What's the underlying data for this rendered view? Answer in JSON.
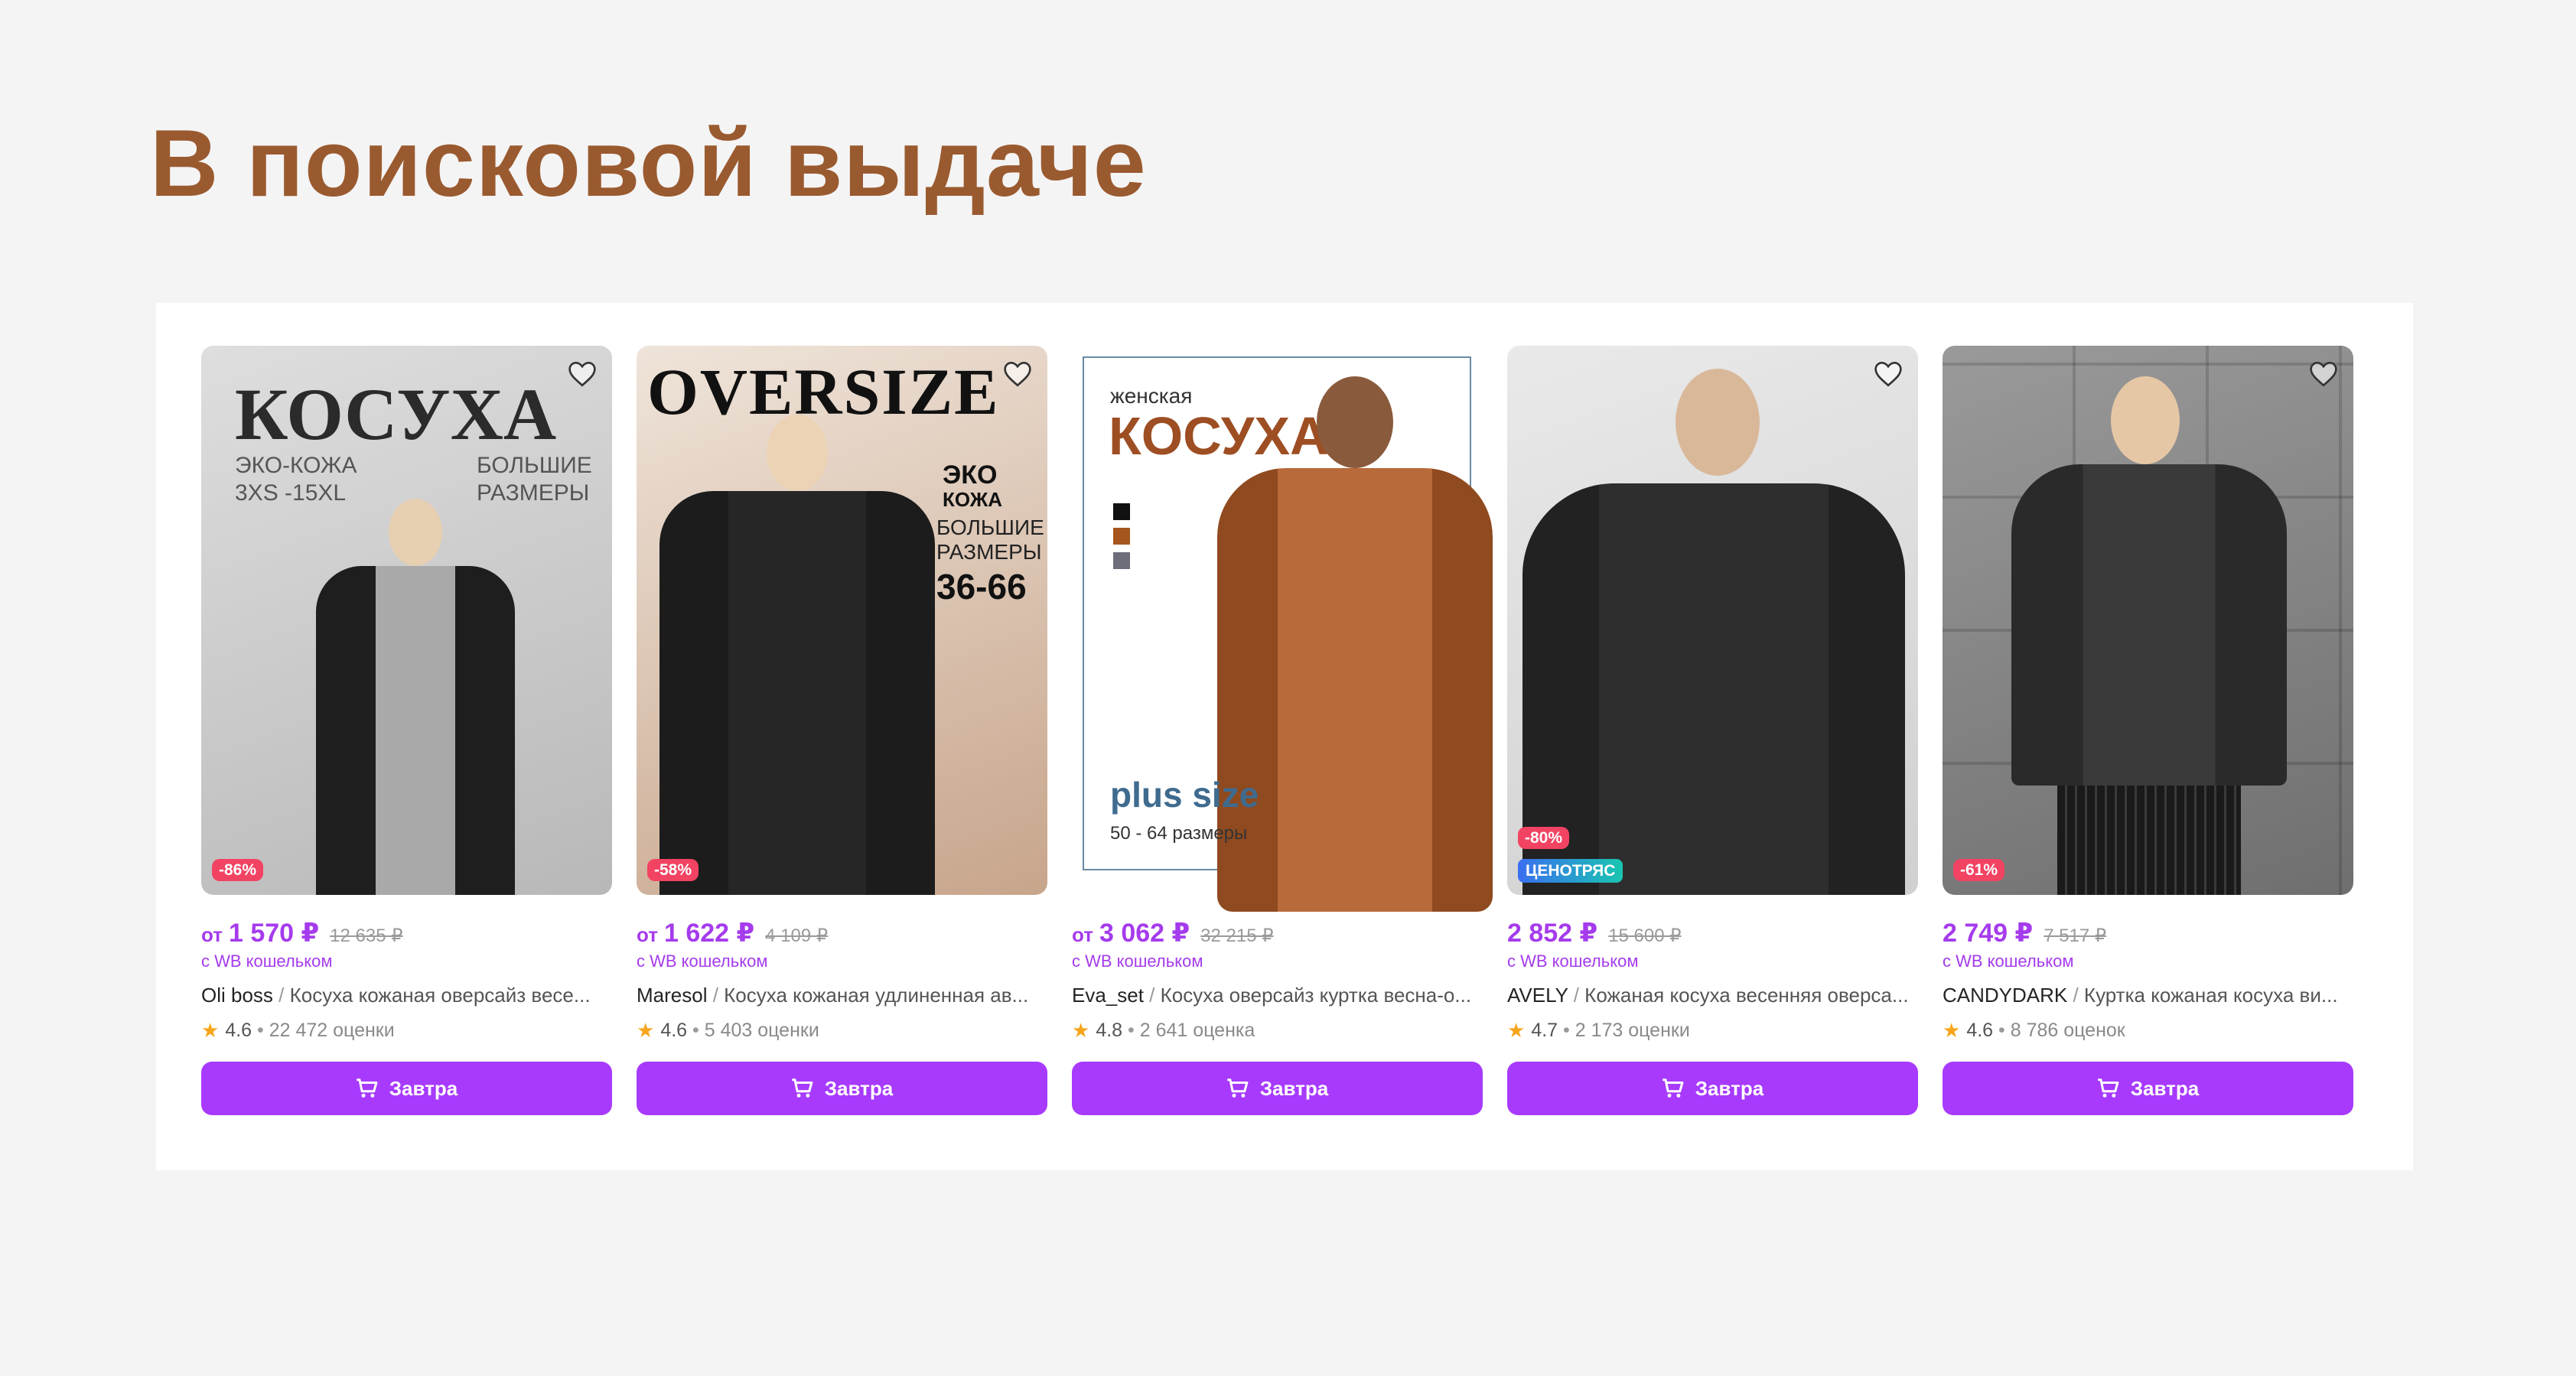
{
  "heading": "В поисковой выдаче",
  "colors": {
    "accent": "#a73afd",
    "price": "#a53bec",
    "heading": "#9a5a2f",
    "discount": "#f24363"
  },
  "cards": [
    {
      "banner": [
        "КОСУХА",
        "ЭКО-КОЖА",
        "3XS -15XL",
        "БОЛЬШИЕ",
        "РАЗМЕРЫ"
      ],
      "badge": "-86%",
      "price_prefix": "от",
      "price": "1 570 ₽",
      "old_price": "12 635 ₽",
      "wallet": "с WB кошельком",
      "brand": "Oli boss",
      "title": "Косуха кожаная оверсайз весе...",
      "rating": "4.6",
      "reviews": "22 472 оценки",
      "cart_label": "Завтра"
    },
    {
      "banner": [
        "OVERSIZE",
        "ЭКО",
        "КОЖА",
        "БОЛЬШИЕ",
        "РАЗМЕРЫ",
        "36-66"
      ],
      "badge": "-58%",
      "price_prefix": "от",
      "price": "1 622 ₽",
      "old_price": "4 109 ₽",
      "wallet": "с WB кошельком",
      "brand": "Maresol",
      "title": "Косуха кожаная удлиненная ав...",
      "rating": "4.6",
      "reviews": "5 403 оценки",
      "cart_label": "Завтра"
    },
    {
      "banner": [
        "женская",
        "КОСУХА",
        "plus size",
        "50 - 64 размеры"
      ],
      "price_prefix": "от",
      "price": "3 062 ₽",
      "old_price": "32 215 ₽",
      "wallet": "с WB кошельком",
      "brand": "Eva_set",
      "title": "Косуха оверсайз куртка весна-о...",
      "rating": "4.8",
      "reviews": "2 641 оценка",
      "cart_label": "Завтра"
    },
    {
      "badge": "-80%",
      "promo": "ЦЕНОТРЯС",
      "price_prefix": "",
      "price": "2 852 ₽",
      "old_price": "15 600 ₽",
      "wallet": "с WB кошельком",
      "brand": "AVELY",
      "title": "Кожаная косуха весенняя оверса...",
      "rating": "4.7",
      "reviews": "2 173 оценки",
      "cart_label": "Завтра"
    },
    {
      "badge": "-61%",
      "price_prefix": "",
      "price": "2 749 ₽",
      "old_price": "7 517 ₽",
      "wallet": "с WB кошельком",
      "brand": "CANDYDARK",
      "title": "Куртка кожаная косуха ви...",
      "rating": "4.6",
      "reviews": "8 786 оценок",
      "cart_label": "Завтра"
    }
  ]
}
